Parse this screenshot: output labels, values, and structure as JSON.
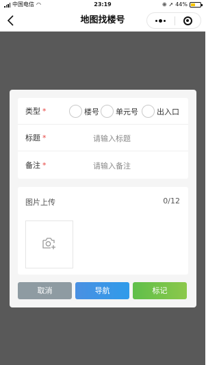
{
  "status_bar": {
    "carrier": "中国电信",
    "time": "23:19",
    "battery_text": "44%",
    "battery_level": 0.44,
    "battery_color": "#f5c400"
  },
  "nav": {
    "title": "地图找楼号",
    "back_icon": "chevron-left-icon",
    "more_icon": "more-dots-icon",
    "close_icon": "target-circle-icon"
  },
  "form": {
    "type": {
      "label": "类型",
      "required_mark": "*",
      "options": [
        "楼号",
        "单元号",
        "出入口"
      ]
    },
    "title": {
      "label": "标题",
      "required_mark": "*",
      "placeholder": "请输入标题"
    },
    "note": {
      "label": "备注",
      "required_mark": "*",
      "placeholder": "请输入备注"
    }
  },
  "upload": {
    "label": "图片上传",
    "count": "0/12",
    "icon": "add-photo-camera-icon"
  },
  "buttons": {
    "cancel": "取消",
    "navigate": "导航",
    "mark": "标记"
  },
  "colors": {
    "overlay": "#595959",
    "required": "#e64340",
    "cancel_button": "#8e9ba2",
    "navigate_button": "#2f9bea",
    "mark_button": "#7cc44a"
  }
}
